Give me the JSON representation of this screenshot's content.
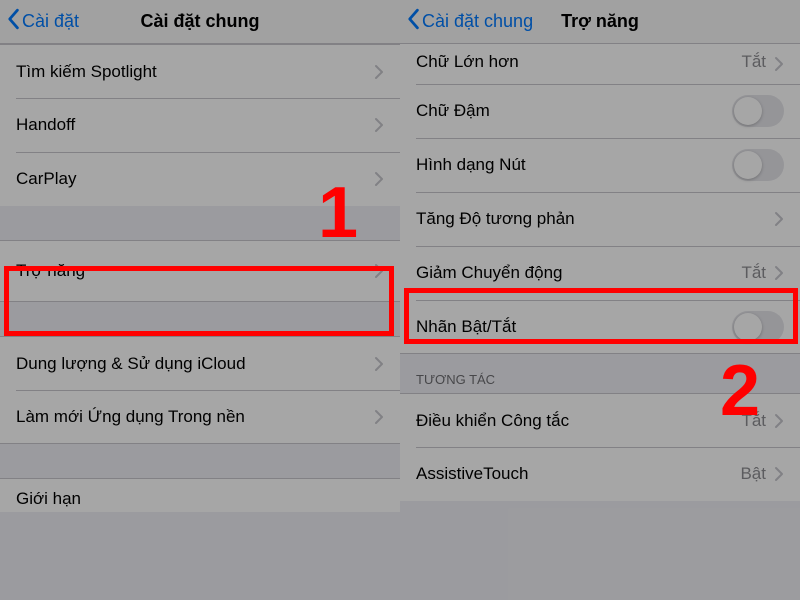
{
  "left": {
    "nav": {
      "back": "Cài đặt",
      "title": "Cài đặt chung"
    },
    "rows": {
      "spotlight": "Tìm kiếm Spotlight",
      "handoff": "Handoff",
      "carplay": "CarPlay",
      "accessibility": "Trợ năng",
      "storage": "Dung lượng & Sử dụng iCloud",
      "bgrefresh": "Làm mới Ứng dụng Trong nền",
      "partial": "Giới hạn"
    }
  },
  "right": {
    "nav": {
      "back": "Cài đặt chung",
      "title": "Trợ năng"
    },
    "rows": {
      "larger_partial": "Chữ Lớn hơn",
      "larger_val": "Tắt",
      "bold": "Chữ Đậm",
      "button_shapes": "Hình dạng Nút",
      "contrast": "Tăng Độ tương phản",
      "reduce_motion": "Giảm Chuyển động",
      "reduce_motion_val": "Tắt",
      "onoff_labels": "Nhãn Bật/Tắt",
      "section_interact": "TƯƠNG TÁC",
      "switch_control": "Điều khiển Công tắc",
      "switch_control_val": "Tắt",
      "assistive": "AssistiveTouch",
      "assistive_val": "Bật"
    }
  },
  "annotations": {
    "num1": "1",
    "num2": "2"
  }
}
